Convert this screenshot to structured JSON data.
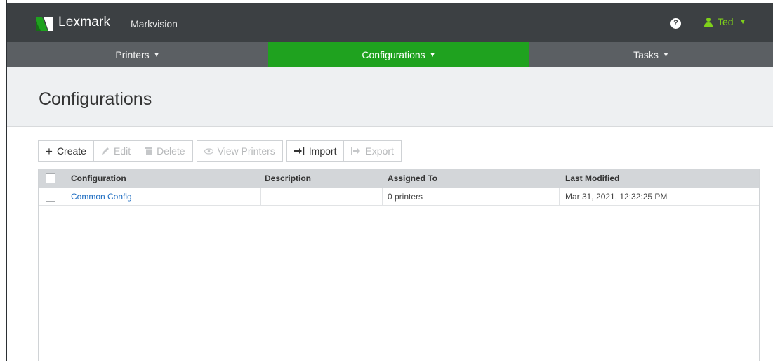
{
  "header": {
    "brand": "Lexmark",
    "product": "Markvision",
    "help_icon": "question-circle-icon",
    "user": {
      "name": "Ted",
      "icon": "user-icon"
    },
    "accent_color": "#7fd11a",
    "bar_color": "#3c4043"
  },
  "nav": {
    "tabs": [
      {
        "label": "Printers",
        "active": false
      },
      {
        "label": "Configurations",
        "active": true
      },
      {
        "label": "Tasks",
        "active": false
      }
    ],
    "active_color": "#1fa21f"
  },
  "page": {
    "title": "Configurations"
  },
  "toolbar": {
    "create": "Create",
    "edit": "Edit",
    "delete": "Delete",
    "view_printers": "View Printers",
    "import": "Import",
    "export": "Export"
  },
  "table": {
    "columns": [
      "Configuration",
      "Description",
      "Assigned To",
      "Last Modified"
    ],
    "rows": [
      {
        "configuration": "Common Config",
        "description": "",
        "assigned_to": "0 printers",
        "last_modified": "Mar 31, 2021, 12:32:25 PM"
      }
    ]
  }
}
